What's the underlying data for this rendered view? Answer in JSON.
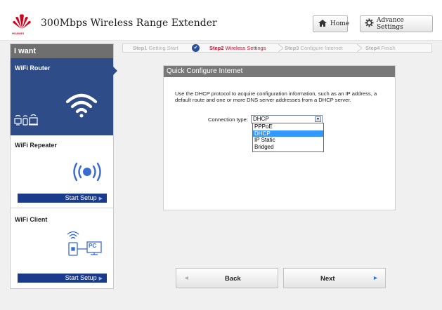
{
  "header": {
    "brand": "HUAWEI",
    "title": "300Mbps Wireless Range Extender",
    "home_label": "Home",
    "advance_label": "Advance Settings",
    "brand_color": "#d4001a"
  },
  "sidebar": {
    "heading": "I want",
    "router": {
      "title": "WiFi Router"
    },
    "repeater": {
      "title": "WiFi Repeater",
      "button": "Start Setup"
    },
    "client": {
      "title": "WiFi Client",
      "button": "Start Setup",
      "pc_label": "PC"
    }
  },
  "steps": [
    {
      "num": "Step1",
      "label": "Getting Start",
      "state": "done"
    },
    {
      "num": "Step2",
      "label": "Wireless Settings",
      "state": "current"
    },
    {
      "num": "Step3",
      "label": "Configure Internet",
      "state": "pending"
    },
    {
      "num": "Step4",
      "label": "Finish",
      "state": "pending"
    }
  ],
  "panel": {
    "title": "Quick Configure Internet",
    "description": "Use the DHCP protocol to acquire configuration information, such as an IP address, a default route and one or more DNS server addresses from a DHCP server.",
    "connection_label": "Connection type:",
    "connection_value": "DHCP",
    "options": [
      "PPPoE",
      "DHCP",
      "IP Static",
      "Bridged"
    ],
    "highlighted_option": "DHCP"
  },
  "nav": {
    "back": "Back",
    "next": "Next"
  },
  "colors": {
    "sidebar_active": "#2e4c87",
    "setup_button": "#1a3b8c",
    "current_step": "#c8102e"
  }
}
